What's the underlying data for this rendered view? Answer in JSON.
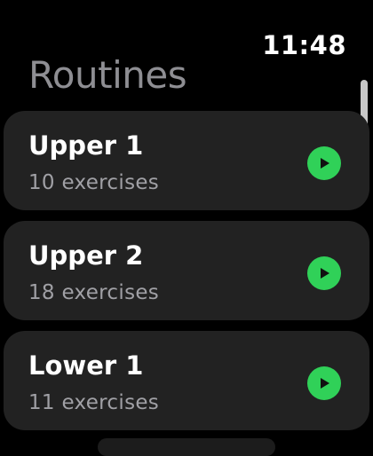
{
  "status": {
    "time": "11:48"
  },
  "header": {
    "title": "Routines"
  },
  "routines": [
    {
      "name": "Upper 1",
      "subtitle": "10 exercises"
    },
    {
      "name": "Upper 2",
      "subtitle": "18 exercises"
    },
    {
      "name": "Lower 1",
      "subtitle": "11 exercises"
    }
  ],
  "colors": {
    "background": "#000000",
    "card": "#222222",
    "accent": "#30d158",
    "title_gray": "#8e8e93",
    "subtitle_gray": "#a0a0a5"
  },
  "icons": {
    "play": "play-icon"
  }
}
